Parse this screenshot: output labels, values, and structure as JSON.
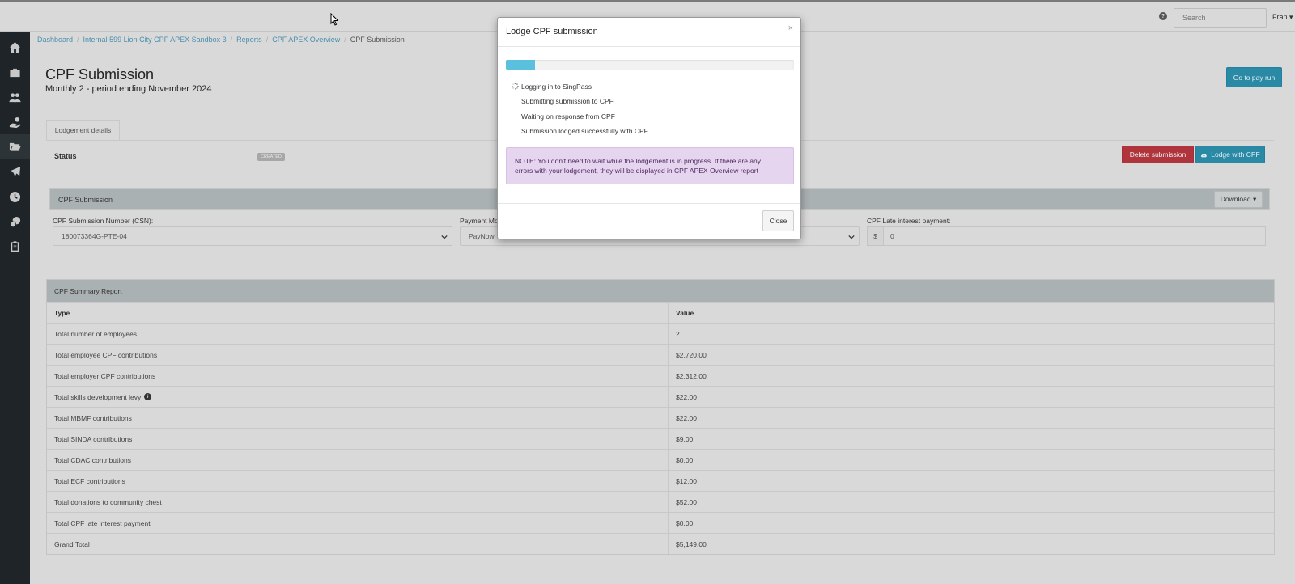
{
  "topbar": {
    "help_icon": "question-circle-icon",
    "search_placeholder": "Search",
    "user_label": "Fran"
  },
  "sidebar": {
    "items": [
      {
        "icon": "home-icon"
      },
      {
        "icon": "briefcase-icon"
      },
      {
        "icon": "people-icon"
      },
      {
        "icon": "hand-money-icon"
      },
      {
        "icon": "folder-open-icon",
        "active": true
      },
      {
        "icon": "plane-icon"
      },
      {
        "icon": "clock-icon"
      },
      {
        "icon": "coins-icon"
      },
      {
        "icon": "clipboard-icon"
      }
    ]
  },
  "breadcrumb": {
    "items": [
      "Dashboard",
      "Internal 599 Lion City CPF APEX Sandbox 3",
      "Reports",
      "CPF APEX Overview"
    ],
    "current": "CPF Submission",
    "separator": "/"
  },
  "page": {
    "title": "CPF Submission",
    "subtitle": "Monthly 2 - period ending November 2024",
    "go_to_pay_run": "Go to pay run"
  },
  "tabs": {
    "lodgement": "Lodgement details"
  },
  "status": {
    "label": "Status",
    "badge": "CREATED",
    "delete_button": "Delete submission",
    "lodge_button": "Lodge with CPF"
  },
  "cpf_panel": {
    "title": "CPF Submission",
    "download": "Download ▾",
    "csn_label": "CPF Submission Number (CSN):",
    "csn_value": "180073364G-PTE-04",
    "payment_label": "Payment Mo",
    "payment_value": "PayNow",
    "late_label": "CPF Late interest payment:",
    "late_prefix": "$",
    "late_value": "0"
  },
  "summary": {
    "title": "CPF Summary Report",
    "col_type": "Type",
    "col_value": "Value",
    "rows": [
      {
        "type": "Total number of employees",
        "value": "2"
      },
      {
        "type": "Total employee CPF contributions",
        "value": "$2,720.00"
      },
      {
        "type": "Total employer CPF contributions",
        "value": "$2,312.00"
      },
      {
        "type": "Total skills development levy",
        "value": "$22.00"
      },
      {
        "type": "Total MBMF contributions",
        "value": "$22.00"
      },
      {
        "type": "Total SINDA contributions",
        "value": "$9.00"
      },
      {
        "type": "Total CDAC contributions",
        "value": "$0.00"
      },
      {
        "type": "Total ECF contributions",
        "value": "$12.00"
      },
      {
        "type": "Total donations to community chest",
        "value": "$52.00"
      },
      {
        "type": "Total CPF late interest payment",
        "value": "$0.00"
      },
      {
        "type": "Grand Total",
        "value": "$5,149.00"
      }
    ]
  },
  "modal": {
    "title": "Lodge CPF submission",
    "close_x": "×",
    "progress": 0.1,
    "steps": [
      "Logging in to SingPass",
      "Submitting submission to CPF",
      "Waiting on response from CPF",
      "Submission lodged successfully with CPF"
    ],
    "note_line1": "NOTE: You don't need to wait while the lodgement is in progress. If there are any",
    "note_line2": "errors with your lodgement, they will be displayed in CPF APEX Overview report",
    "close_button": "Close"
  },
  "colors": {
    "accent": "#5bc0de",
    "primary_button": "#2a8aa6",
    "danger_button": "#b0343c",
    "note_bg": "#e6d5ef",
    "sidebar": "#1e2427"
  }
}
